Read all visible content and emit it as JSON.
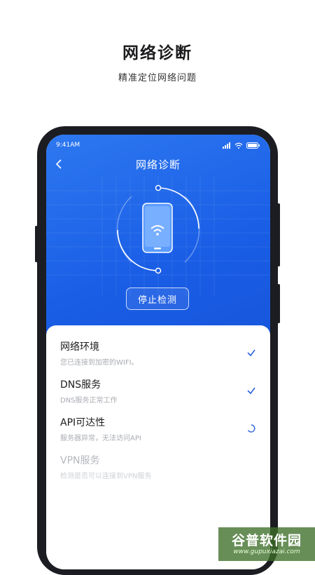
{
  "promo": {
    "title": "网络诊断",
    "subtitle": "精准定位网络问题"
  },
  "status_bar": {
    "time": "9:41AM"
  },
  "nav": {
    "title": "网络诊断"
  },
  "actions": {
    "stop_label": "停止检测"
  },
  "checks": [
    {
      "title": "网络环境",
      "desc": "您已连接到加密的WIFI。",
      "status": "check-icon"
    },
    {
      "title": "DNS服务",
      "desc": "DNS服务正常工作",
      "status": "check-icon"
    },
    {
      "title": "API可达性",
      "desc": "服务器异常，无法访问API",
      "status": "loading-spinner-icon"
    },
    {
      "title": "VPN服务",
      "desc": "检测是否可以连接到VPN服务",
      "status": "pending"
    }
  ],
  "watermark": {
    "text": "谷普软件园",
    "url": "www.gupuxiazai.com"
  },
  "colors": {
    "accent": "#1a5ee6",
    "check": "#2b63d9"
  }
}
